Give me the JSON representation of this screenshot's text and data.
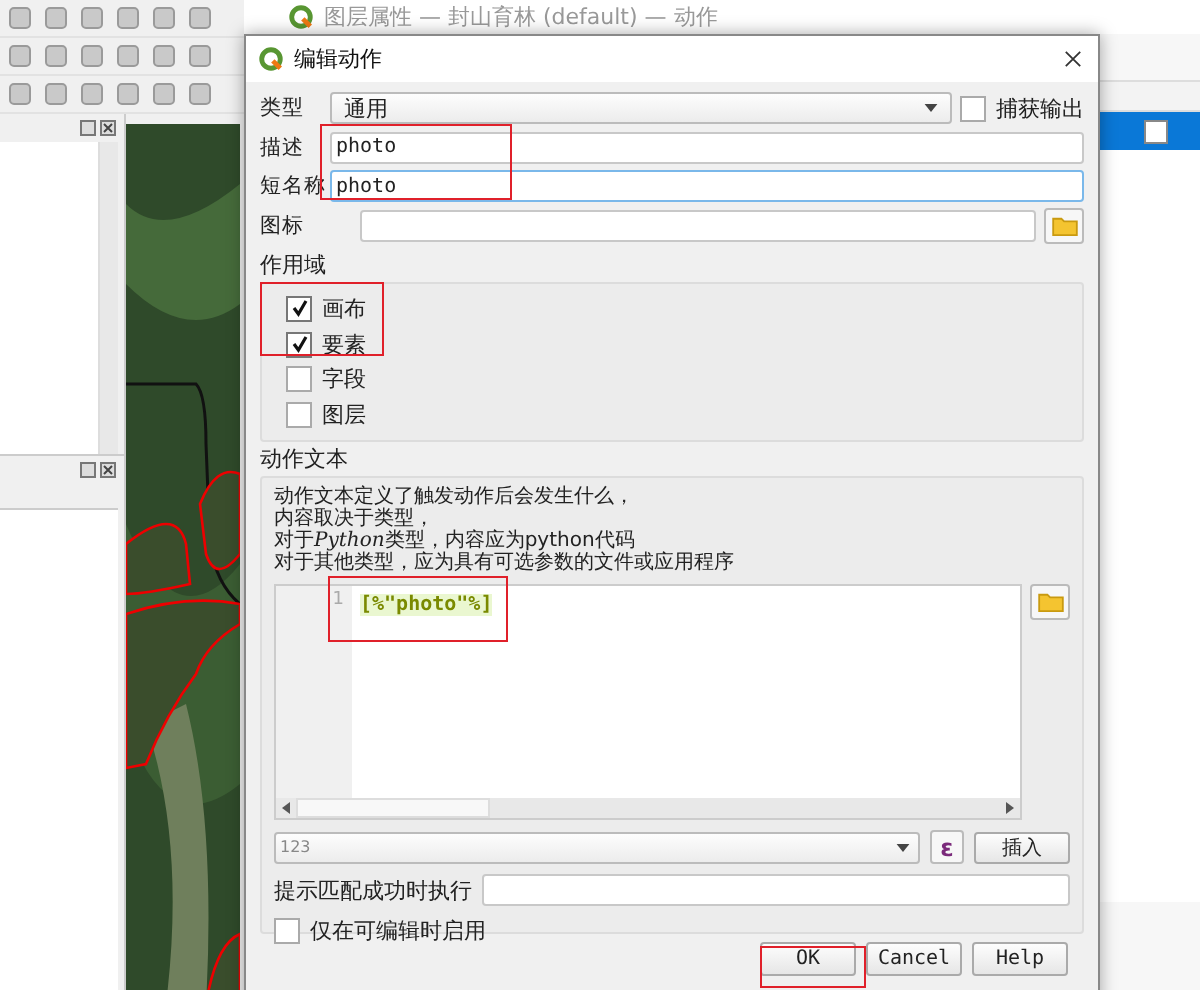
{
  "background_window": {
    "title": "图层属性 — 封山育林 (default) — 动作",
    "table": {
      "rows": [
        {
          "selected": true,
          "checked": false
        }
      ]
    }
  },
  "dialog": {
    "title": "编辑动作",
    "type": {
      "label": "类型",
      "value": "通用"
    },
    "capture_output": {
      "label": "捕获输出",
      "checked": false
    },
    "description": {
      "label": "描述",
      "value": "photo",
      "focused": false
    },
    "short_name": {
      "label": "短名称",
      "value": "photo",
      "focused": true
    },
    "icon": {
      "label": "图标"
    },
    "scope": {
      "title": "作用域",
      "items": [
        {
          "label": "画布",
          "checked": true
        },
        {
          "label": "要素",
          "checked": true
        },
        {
          "label": "字段",
          "checked": false
        },
        {
          "label": "图层",
          "checked": false
        }
      ]
    },
    "action_text": {
      "title": "动作文本",
      "help_lines": [
        [
          {
            "text": "动作文本定义了触发动作后会发生什么，",
            "italic": false
          }
        ],
        [
          {
            "text": "内容取决于类型，",
            "italic": false
          }
        ],
        [
          {
            "text": "对于",
            "italic": false
          },
          {
            "text": "Python",
            "italic": true
          },
          {
            "text": "类型，内容应为python代码",
            "italic": false
          }
        ],
        [
          {
            "text": "对于其他类型，应为具有可选参数的文件或应用程序",
            "italic": false
          }
        ]
      ],
      "line_number": "1",
      "code": "[%\"photo\"%]",
      "expression": {
        "placeholder": "123"
      },
      "expression_button": "ε",
      "insert_button": "插入"
    },
    "notify": {
      "label": "提示匹配成功时执行"
    },
    "editable_only": {
      "label": "仅在可编辑时启用",
      "checked": false
    },
    "buttons": [
      "OK",
      "Cancel",
      "Help"
    ]
  }
}
